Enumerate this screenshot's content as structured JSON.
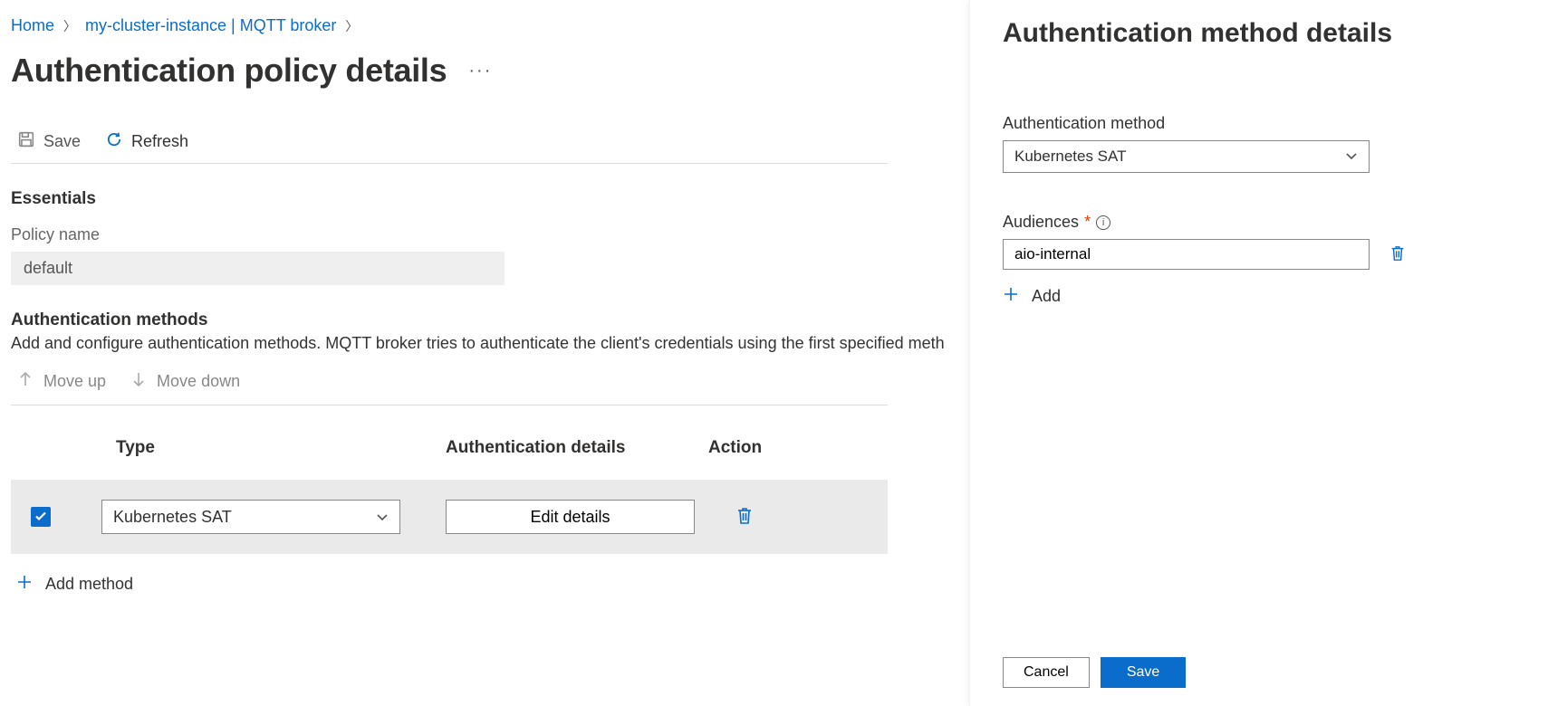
{
  "breadcrumbs": {
    "home": "Home",
    "cluster": "my-cluster-instance | MQTT broker"
  },
  "page": {
    "title": "Authentication policy details"
  },
  "toolbar": {
    "save": "Save",
    "refresh": "Refresh"
  },
  "essentials": {
    "heading": "Essentials",
    "policy_name_label": "Policy name",
    "policy_name_value": "default"
  },
  "authMethods": {
    "heading": "Authentication methods",
    "description": "Add and configure authentication methods. MQTT broker tries to authenticate the client's credentials using the first specified meth",
    "move_up": "Move up",
    "move_down": "Move down",
    "columns": {
      "type": "Type",
      "details": "Authentication details",
      "action": "Action"
    },
    "rows": [
      {
        "type": "Kubernetes SAT",
        "edit_label": "Edit details"
      }
    ],
    "add_method": "Add method"
  },
  "panel": {
    "title": "Authentication method details",
    "method_label": "Authentication method",
    "method_value": "Kubernetes SAT",
    "audiences_label": "Audiences",
    "audiences": [
      "aio-internal"
    ],
    "add": "Add",
    "cancel": "Cancel",
    "save": "Save"
  }
}
